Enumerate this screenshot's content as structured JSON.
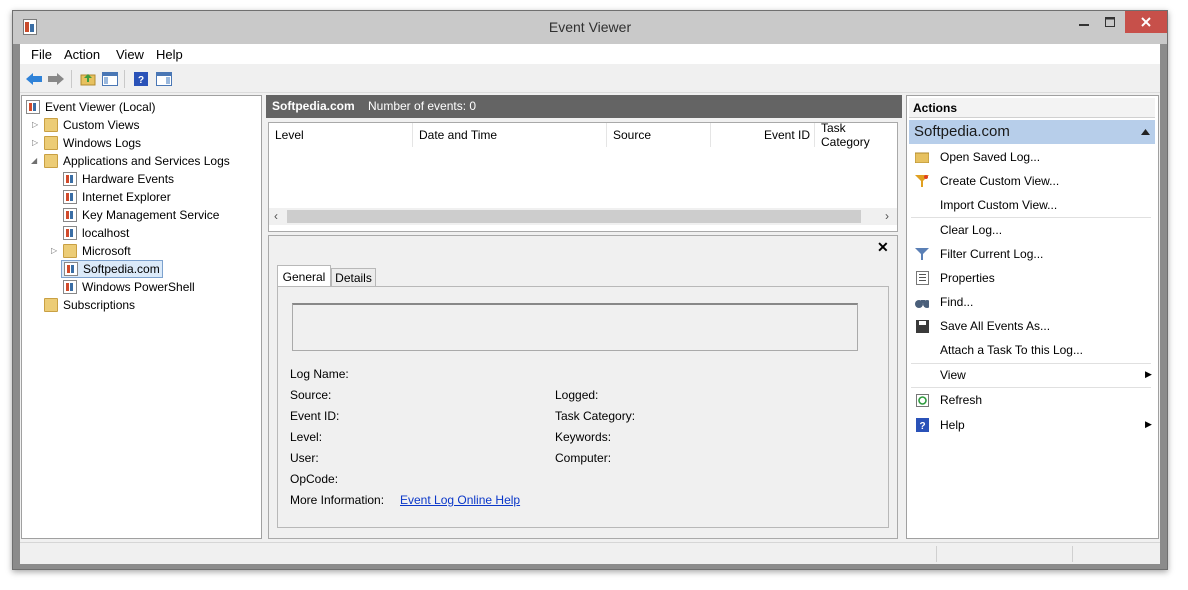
{
  "window": {
    "title": "Event Viewer"
  },
  "menu": [
    "File",
    "Action",
    "View",
    "Help"
  ],
  "tree": {
    "root": "Event Viewer (Local)",
    "custom_views": "Custom Views",
    "windows_logs": "Windows Logs",
    "apps_services": "Applications and Services Logs",
    "children": [
      "Hardware Events",
      "Internet Explorer",
      "Key Management Service",
      "localhost"
    ],
    "microsoft": "Microsoft",
    "selected": "Softpedia.com",
    "powershell": "Windows PowerShell",
    "subscriptions": "Subscriptions"
  },
  "log_panel": {
    "log_name": "Softpedia.com",
    "event_count": "Number of events: 0",
    "columns": [
      "Level",
      "Date and Time",
      "Source",
      "Event ID",
      "Task Category"
    ]
  },
  "detail": {
    "tabs": [
      "General",
      "Details"
    ],
    "fields_left": [
      "Log Name:",
      "Source:",
      "Event ID:",
      "Level:",
      "User:",
      "OpCode:"
    ],
    "fields_right": [
      "Logged:",
      "Task Category:",
      "Keywords:",
      "Computer:"
    ],
    "more_info_label": "More Information:",
    "more_info_link": "Event Log Online Help"
  },
  "actions": {
    "header": "Actions",
    "section": "Softpedia.com",
    "items": [
      {
        "label": "Open Saved Log...",
        "icon": "open-folder-icon"
      },
      {
        "label": "Create Custom View...",
        "icon": "filter-star-icon"
      },
      {
        "label": "Import Custom View...",
        "icon": ""
      },
      {
        "label": "Clear Log...",
        "icon": ""
      },
      {
        "label": "Filter Current Log...",
        "icon": "filter-icon"
      },
      {
        "label": "Properties",
        "icon": "properties-icon"
      },
      {
        "label": "Find...",
        "icon": "binoculars-icon"
      },
      {
        "label": "Save All Events As...",
        "icon": "save-icon"
      },
      {
        "label": "Attach a Task To this Log...",
        "icon": ""
      },
      {
        "label": "View",
        "icon": ""
      },
      {
        "label": "Refresh",
        "icon": "refresh-icon"
      },
      {
        "label": "Help",
        "icon": "help-icon"
      }
    ]
  },
  "colors": {
    "accent": "#b7ceea",
    "close": "#c7504a",
    "link": "#0a37c9",
    "header": "#646464"
  }
}
